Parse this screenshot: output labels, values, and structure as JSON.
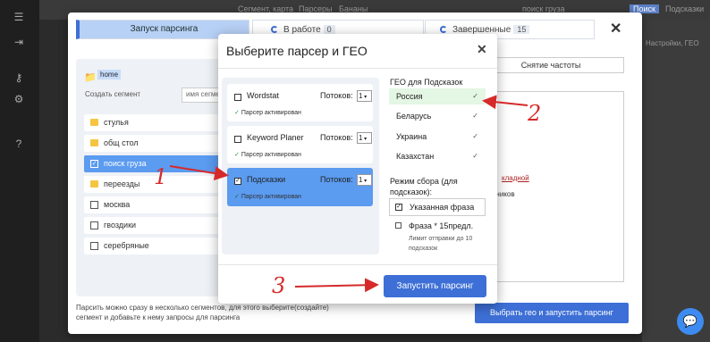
{
  "background": {
    "top_links": [
      "Сегмент, карта",
      "Парсеры",
      "Бананы"
    ],
    "search_value": "поиск груза",
    "top_button": "Поиск",
    "right_menu": "Подсказки",
    "right_tab_fragment": "Настройки, ГЕО",
    "bg_words": [
      "кладной",
      "едиников"
    ]
  },
  "outer_modal": {
    "tabs": [
      {
        "label": "Запуск парсинга"
      },
      {
        "label": "В работе",
        "count": "0"
      },
      {
        "label": "Завершенные",
        "count": "15"
      }
    ],
    "home_chip": "home",
    "create_segment_label": "Создать сегмент",
    "segment_name_placeholder": "имя сегмента",
    "segments": [
      {
        "label": "стулья",
        "kind": "folder"
      },
      {
        "label": "общ стол",
        "kind": "folder"
      },
      {
        "label": "поиск груза",
        "kind": "checkbox",
        "selected": true
      },
      {
        "label": "переезды",
        "kind": "folder"
      },
      {
        "label": "москва",
        "kind": "checkbox"
      },
      {
        "label": "гвоздики",
        "kind": "checkbox"
      },
      {
        "label": "серебряные",
        "kind": "checkbox"
      }
    ],
    "freq_button": "Снятие частоты",
    "footnote": "Парсить можно сразу в несколько сегментов, для этого выберите(создайте) сегмент и добавьте к нему запросы для парсинга",
    "submit": "Выбрать гео и запустить парсинг"
  },
  "inner_modal": {
    "title": "Выберите парсер и ГЕО",
    "parsers": [
      {
        "name": "Wordstat",
        "threads_label": "Потоков:",
        "threads": "1",
        "status": "Парсер активирован",
        "checked": false
      },
      {
        "name": "Keyword Planer",
        "threads_label": "Потоков:",
        "threads": "1",
        "status": "Парсер активирован",
        "checked": false
      },
      {
        "name": "Подсказки",
        "threads_label": "Потоков:",
        "threads": "1",
        "status": "Парсер активирован",
        "checked": true
      }
    ],
    "geo_title": "ГЕО для Подсказок",
    "geo": [
      {
        "label": "Россия",
        "selected": true
      },
      {
        "label": "Беларусь"
      },
      {
        "label": "Украина"
      },
      {
        "label": "Казахстан"
      }
    ],
    "mode_title": "Режим сбора (для подсказок):",
    "mode_selected": "Указанная фраза",
    "mode_alt": "Фраза * 15предл.",
    "mode_alt_note": "Лимит отправки до 10 подсказок",
    "submit": "Запустить парсинг"
  },
  "annotations": [
    "1",
    "2",
    "3"
  ],
  "colors": {
    "accent": "#3d6fd6",
    "selection": "#5b9bf0",
    "annotation": "#d62a2a",
    "geo_selected": "#e4f6e4"
  }
}
